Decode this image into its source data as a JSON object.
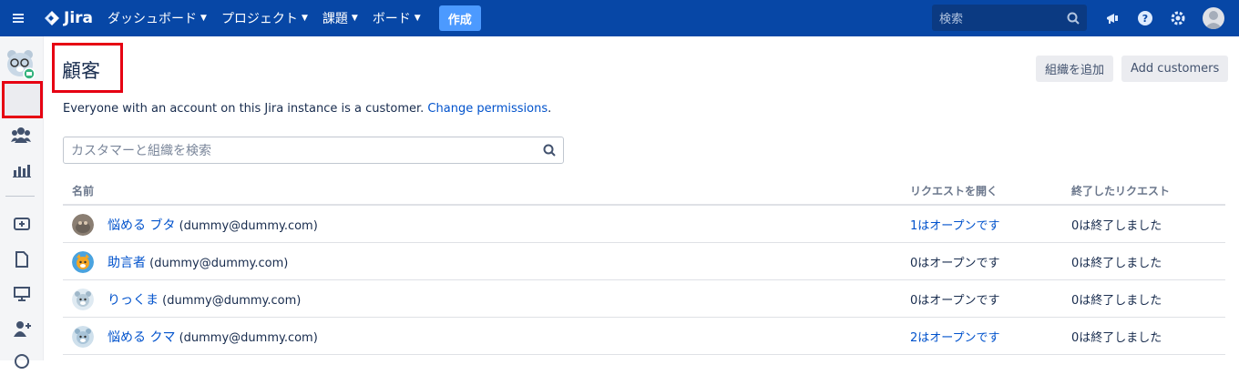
{
  "topnav": {
    "logo": "Jira",
    "items": [
      {
        "label": "ダッシュボード"
      },
      {
        "label": "プロジェクト"
      },
      {
        "label": "課題"
      },
      {
        "label": "ボード"
      }
    ],
    "create": "作成",
    "search_placeholder": "検索"
  },
  "page": {
    "title": "顧客",
    "add_org": "組織を追加",
    "add_customers": "Add customers",
    "info_text": "Everyone with an account on this Jira instance is a customer. ",
    "info_link": "Change permissions",
    "info_end": ".",
    "search_placeholder": "カスタマーと組織を検索"
  },
  "table": {
    "columns": [
      "名前",
      "リクエストを開く",
      "終了したリクエスト"
    ],
    "rows": [
      {
        "name": "悩める ブタ",
        "email": " (dummy@dummy.com)",
        "open": "1はオープンです",
        "open_link": true,
        "closed": "0は終了しました"
      },
      {
        "name": "助言者",
        "email": " (dummy@dummy.com)",
        "open": "0はオープンです",
        "open_link": false,
        "closed": "0は終了しました"
      },
      {
        "name": "りっくま",
        "email": " (dummy@dummy.com)",
        "open": "0はオープンです",
        "open_link": false,
        "closed": "0は終了しました"
      },
      {
        "name": "悩める クマ",
        "email": " (dummy@dummy.com)",
        "open": "2はオープンです",
        "open_link": true,
        "closed": "0は終了しました"
      }
    ]
  }
}
